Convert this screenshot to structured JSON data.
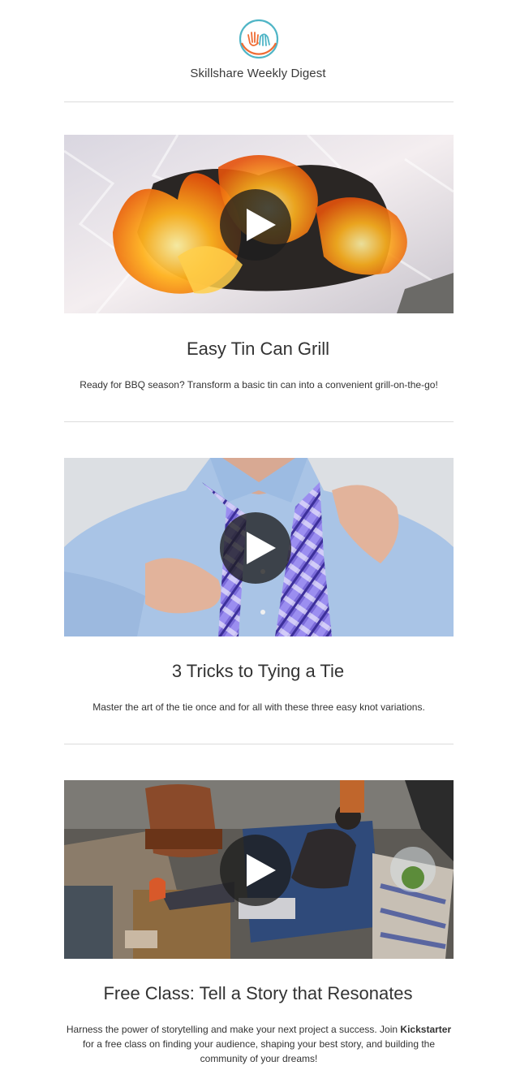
{
  "header": {
    "logo_icon": "skillshare-hands-logo-icon",
    "title": "Skillshare Weekly Digest"
  },
  "cards": [
    {
      "image": "grill-fire-on-foil-image",
      "title": "Easy Tin Can Grill",
      "description": "Ready for BBQ season? Transform a basic tin can into a convenient grill-on-the-go!"
    },
    {
      "image": "man-tying-tie-image",
      "title": "3 Tricks to Tying a Tie",
      "description": "Master the art of the tie once and for all with these three easy knot variations."
    },
    {
      "image": "man-with-laptop-on-couch-image",
      "title": "Free Class: Tell a Story that Resonates",
      "description_before": "Harness the power of storytelling and make your next project a success. Join ",
      "description_bold": "Kickstarter",
      "description_after": " for a free class on finding your audience, shaping your best story, and building the community of your dreams!"
    }
  ],
  "colors": {
    "logo_teal": "#4fb5c6",
    "logo_orange": "#ef6c34",
    "divider": "#dcdcdc",
    "play_overlay": "#1e1e1e"
  }
}
